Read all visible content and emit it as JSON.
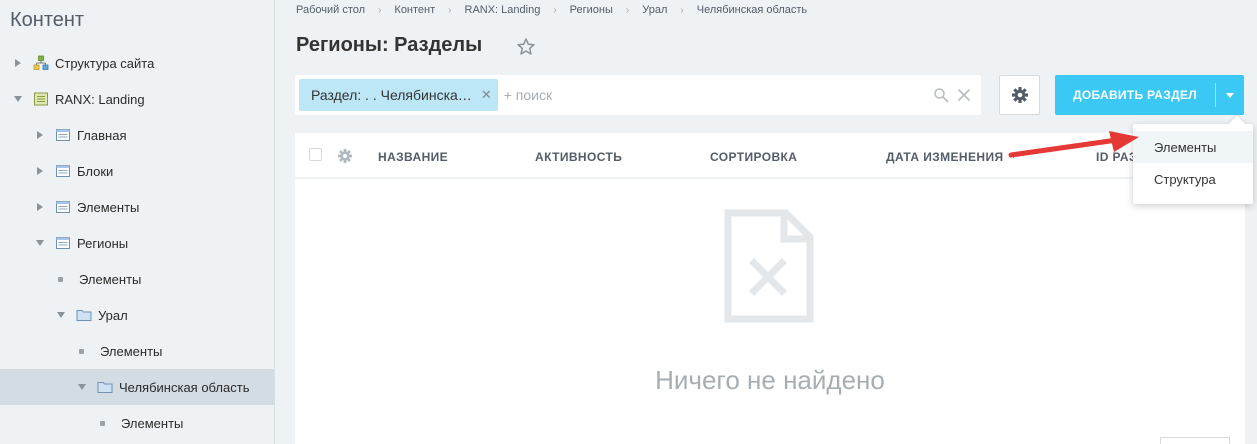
{
  "sidebar": {
    "title": "Контент",
    "items": [
      {
        "label": "Структура сайта",
        "icon": "site-structure-icon"
      },
      {
        "label": "RANX: Landing",
        "icon": "iblock-type-icon"
      },
      {
        "label": "Главная",
        "icon": "iblock-icon"
      },
      {
        "label": "Блоки",
        "icon": "iblock-icon"
      },
      {
        "label": "Элементы",
        "icon": "iblock-icon"
      },
      {
        "label": "Регионы",
        "icon": "iblock-icon"
      },
      {
        "label": "Элементы",
        "icon": "bullet"
      },
      {
        "label": "Урал",
        "icon": "folder-icon"
      },
      {
        "label": "Элементы",
        "icon": "bullet"
      },
      {
        "label": "Челябинская область",
        "icon": "folder-icon"
      },
      {
        "label": "Элементы",
        "icon": "bullet"
      }
    ]
  },
  "breadcrumb": [
    "Рабочий стол",
    "Контент",
    "RANX: Landing",
    "Регионы",
    "Урал",
    "Челябинская область"
  ],
  "page": {
    "title": "Регионы: Разделы"
  },
  "filter": {
    "chip_label": "Раздел: . . Челябинска…",
    "search_placeholder": "+ поиск"
  },
  "toolbar": {
    "add_label": "ДОБАВИТЬ РАЗДЕЛ"
  },
  "grid": {
    "columns": [
      "НАЗВАНИЕ",
      "АКТИВНОСТЬ",
      "СОРТИРОВКА",
      "ДАТА ИЗМЕНЕНИЯ",
      "ID РАЗ"
    ],
    "empty_text": "Ничего не найдено"
  },
  "menu": {
    "items": [
      "Элементы",
      "Структура"
    ]
  },
  "colors": {
    "accent": "#3bc8f5",
    "chip": "#bde7f6",
    "annotation": "#e53935",
    "selected": "#d2dce2"
  }
}
